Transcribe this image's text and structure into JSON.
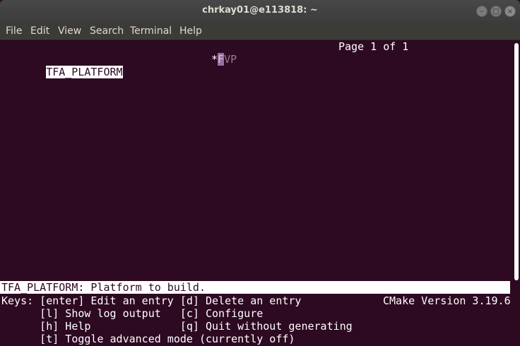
{
  "window": {
    "title": "chrkay01@e113818: ~",
    "controls": {
      "minimize": "–",
      "maximize": "□",
      "close": "×"
    }
  },
  "menu": [
    "File",
    "Edit",
    "View",
    "Search",
    "Terminal",
    "Help"
  ],
  "ccmake": {
    "page": "Page 1 of 1",
    "entries": [
      {
        "name": "TFA_PLATFORM",
        "marker": "*",
        "value_cursor": "F",
        "value_rest": "VP"
      }
    ],
    "status": "TFA_PLATFORM: Platform to build.",
    "keys_line1": "Keys: [enter] Edit an entry [d] Delete an entry",
    "version": "CMake Version 3.19.6",
    "keys_line2": "      [l] Show log output   [c] Configure",
    "keys_line3": "      [h] Help              [q] Quit without generating",
    "keys_line4": "      [t] Toggle advanced mode (currently off)"
  },
  "colors": {
    "terminal_bg": "#2d0922",
    "titlebar": "#3c3b37",
    "cursor": "#9a6fa3"
  }
}
